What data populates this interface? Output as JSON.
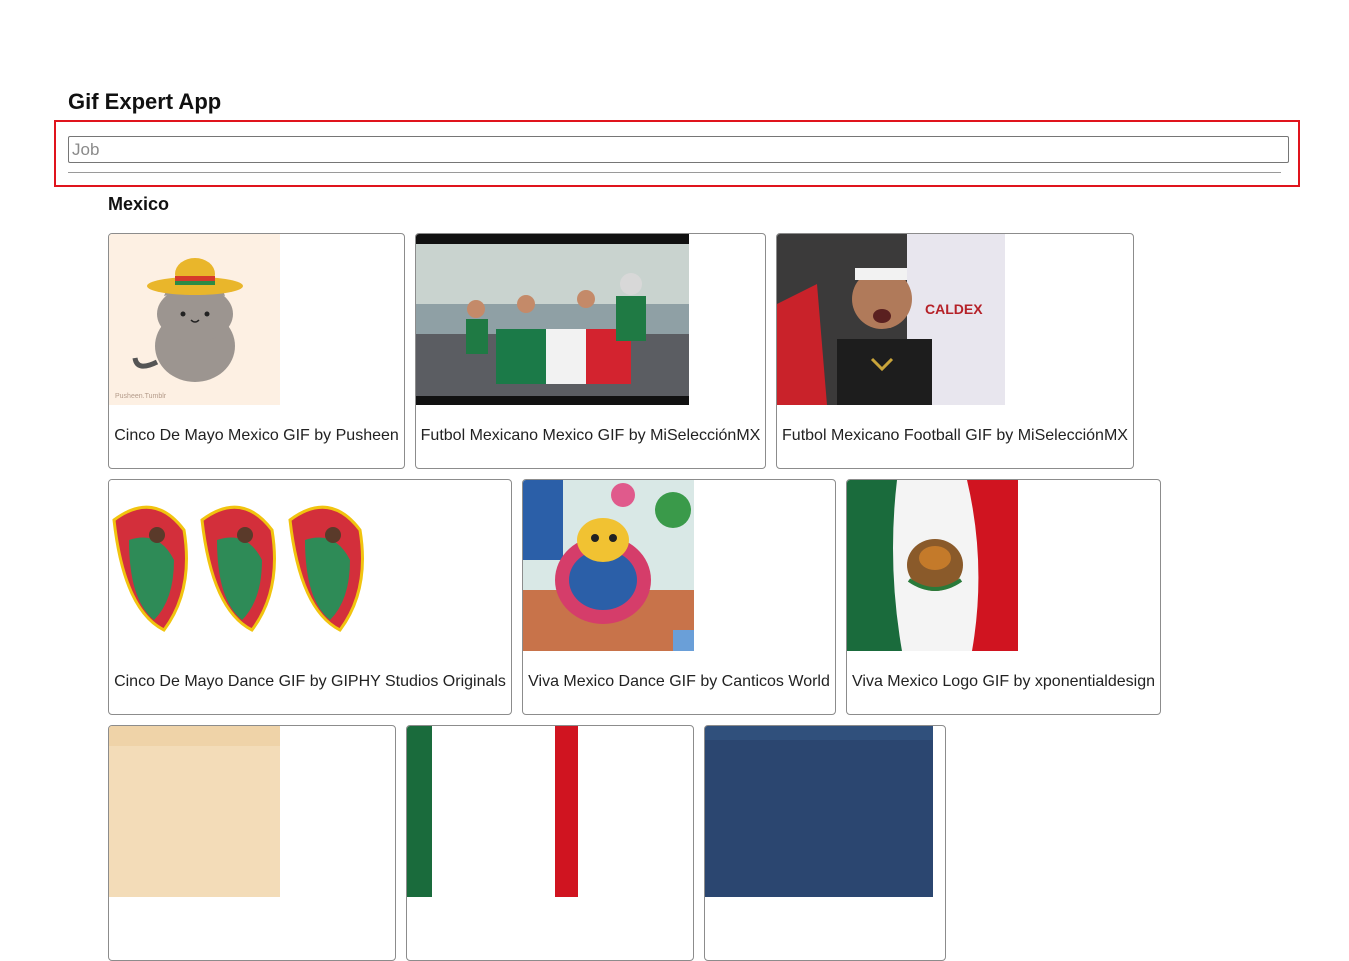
{
  "app": {
    "title": "Gif Expert App"
  },
  "search": {
    "placeholder": "Job",
    "value": ""
  },
  "category": {
    "name": "Mexico"
  },
  "gifs": [
    {
      "title": "Cinco De Mayo Mexico GIF by Pusheen",
      "image": "pusheen-sombrero-cat"
    },
    {
      "title": "Futbol Mexicano Mexico GIF by MiSelecciónMX",
      "image": "fans-with-flag"
    },
    {
      "title": "Futbol Mexicano Football GIF by MiSelecciónMX",
      "image": "cheering-fan"
    },
    {
      "title": "Cinco De Mayo Dance GIF by GIPHY Studios Originals",
      "image": "folk-dancers"
    },
    {
      "title": "Viva Mexico Dance GIF by Canticos World",
      "image": "cartoon-dancer"
    },
    {
      "title": "Viva Mexico Logo GIF by xponentialdesign",
      "image": "mexican-flag"
    },
    {
      "title": "",
      "image": "beige-texture"
    },
    {
      "title": "",
      "image": "flag-stripes"
    },
    {
      "title": "",
      "image": "blue-photo"
    }
  ],
  "colors": {
    "highlight_border": "#e0141d",
    "mexico_green": "#006847",
    "mexico_red": "#ce1126"
  }
}
